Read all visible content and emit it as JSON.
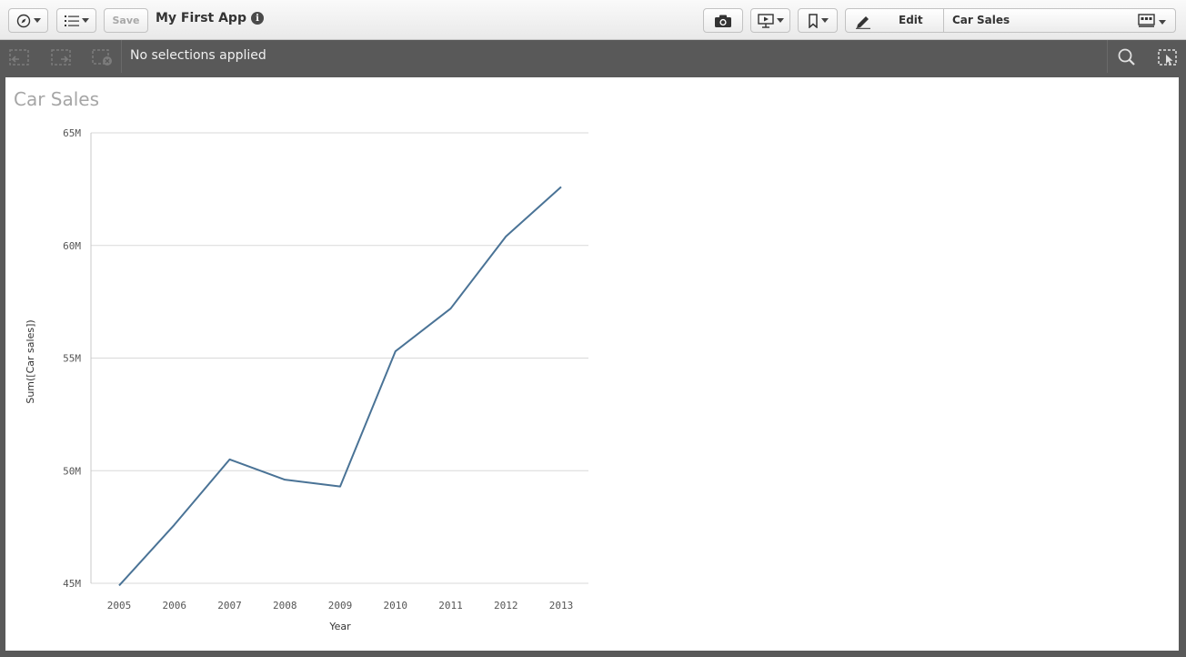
{
  "toolbar": {
    "save_label": "Save",
    "app_title": "My First App",
    "info_glyph": "i",
    "edit_label": "Edit",
    "sheet_name": "Car Sales"
  },
  "icons": [
    "navigation-compass-icon",
    "global-menu-icon",
    "snapshot-camera-icon",
    "story-presentation-icon",
    "bookmark-icon",
    "pencil-icon",
    "sheet-list-icon",
    "step-back-icon",
    "step-forward-icon",
    "clear-selections-icon",
    "search-icon",
    "selections-tool-icon"
  ],
  "selections": {
    "status": "No selections applied"
  },
  "colors": {
    "line": "#4a7396",
    "title": "#a6a6a6",
    "selbar": "#595959"
  },
  "chart_data": {
    "type": "line",
    "title": "Car Sales",
    "xlabel": "Year",
    "ylabel": "Sum([Car sales])",
    "ylim": [
      45000000,
      65000000
    ],
    "yticks": [
      "45M",
      "50M",
      "55M",
      "60M",
      "65M"
    ],
    "categories": [
      "2005",
      "2006",
      "2007",
      "2008",
      "2009",
      "2010",
      "2011",
      "2012",
      "2013"
    ],
    "series": [
      {
        "values": [
          44900000,
          47600000,
          50500000,
          49600000,
          49300000,
          55300000,
          57200000,
          60400000,
          62600000
        ]
      }
    ],
    "grid": true
  }
}
